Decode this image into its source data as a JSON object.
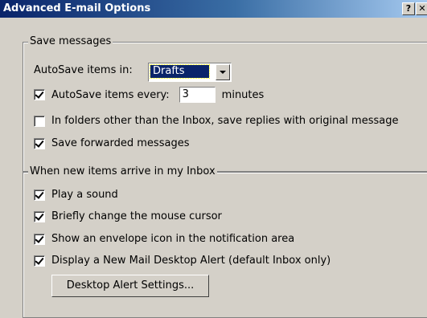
{
  "window": {
    "title": "Advanced E-mail Options",
    "help_button": "?",
    "close_button": "✕"
  },
  "save_messages": {
    "label": "Save messages",
    "autosave_in_label": "AutoSave items in:",
    "autosave_folder": "Drafts",
    "autosave_every_label": "AutoSave items every:",
    "autosave_every_value": "3",
    "minutes_label": "minutes",
    "autosave_every_checked": true,
    "other_folders_label": "In folders other than the Inbox, save replies with original message",
    "other_folders_checked": false,
    "save_forwarded_label": "Save forwarded messages",
    "save_forwarded_checked": true
  },
  "new_items": {
    "label": "When new items arrive in my Inbox",
    "play_sound_label": "Play a sound",
    "play_sound_checked": true,
    "change_cursor_label": "Briefly change the mouse cursor",
    "change_cursor_checked": true,
    "envelope_icon_label": "Show an envelope icon in the notification area",
    "envelope_icon_checked": true,
    "desktop_alert_label": "Display a New Mail Desktop Alert (default Inbox only)",
    "desktop_alert_checked": true,
    "alert_settings_button": "Desktop Alert Settings..."
  }
}
